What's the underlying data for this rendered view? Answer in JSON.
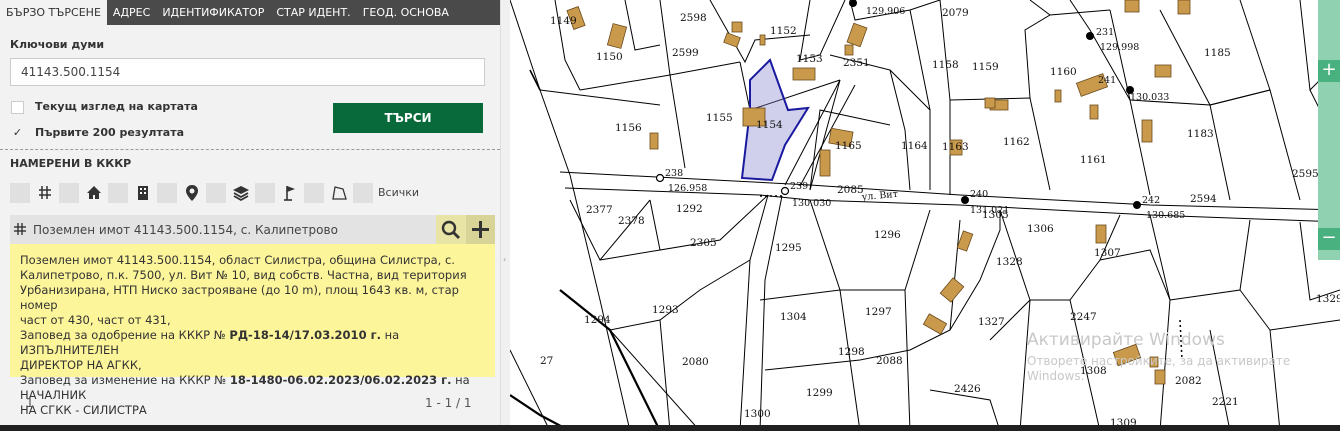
{
  "tabs": [
    "БЪРЗО ТЪРСЕНЕ",
    "АДРЕС",
    "ИДЕНТИФИКАТОР",
    "СТАР ИДЕНТ.",
    "ГЕОД. ОСНОВА"
  ],
  "keywords": {
    "label": "Ключови думи",
    "value": "41143.500.1154"
  },
  "checkboxes": [
    {
      "label": "Текущ изглед на картата",
      "checked": false
    },
    {
      "label": "Първите 200 резултата",
      "checked": true
    }
  ],
  "search_label": "ТЪРСИ",
  "found": {
    "title": "НАМЕРЕНИ В КККР",
    "all_label": "Всички"
  },
  "filter_icons": [
    "grid-icon",
    "home-icon",
    "building-icon",
    "pin-icon",
    "layers-icon",
    "flag-icon",
    "polygon-icon"
  ],
  "result": {
    "title": "Поземлен имот 41143.500.1154, с. Калипетрово",
    "lines": [
      "Поземлен имот 41143.500.1154, област Силистра, община Силистра, с.",
      "Калипетрово, п.к. 7500, ул. Вит № 10, вид собств. Частна, вид територия",
      "Урбанизирана, НТП Ниско застрояване (до 10 m), площ 1643 кв. м, стар номер",
      "част от 430, част от 431,"
    ],
    "order1_prefix": "Заповед за одобрение на КККР № ",
    "order1_bold": "РД-18-14/17.03.2010 г.",
    "order1_suffix": " на ИЗПЪЛНИТЕЛЕН",
    "order1_line2": "ДИРЕКТОР НА АГКК,",
    "order2_prefix": "Заповед за изменение на КККР № ",
    "order2_bold": "18-1480-06.02.2023/06.02.2023 г.",
    "order2_suffix": " на НАЧАЛНИК",
    "order2_line2": "НА СГКК - СИЛИСТРА"
  },
  "pagination": {
    "page": "1",
    "count": "1 - 1 / 1"
  },
  "map": {
    "parcels": [
      "1149",
      "2598",
      "1152",
      "2599",
      "1150",
      "1153",
      "2351",
      "1158",
      "1159",
      "1160",
      "1185",
      "1155",
      "1154",
      "1156",
      "1165",
      "1164",
      "1163",
      "1162",
      "1161",
      "1183",
      "2595",
      "2377",
      "2378",
      "1292",
      "2305",
      "2085",
      "1295",
      "1296",
      "1305",
      "1306",
      "2594",
      "1328",
      "1307",
      "1294",
      "1293",
      "1304",
      "1297",
      "1327",
      "2247",
      "27",
      "2080",
      "1298",
      "2088",
      "2426",
      "1308",
      "2082",
      "2221",
      "1299",
      "1300",
      "1309",
      "1329",
      "2079"
    ],
    "points": [
      {
        "id": "238",
        "elev": "126.958"
      },
      {
        "id": "239",
        "elev": "130.030"
      },
      {
        "id": "240",
        "elev": "131.021"
      },
      {
        "id": "242",
        "elev": "130.685"
      },
      {
        "id": "241",
        "elev": "130.033"
      },
      {
        "id": "231",
        "elev": "129.998"
      },
      {
        "id": "",
        "elev": "129.906"
      }
    ],
    "street": "ул. Вит",
    "highlight_color": "#1a1aa0"
  },
  "watermark": {
    "title": "Активирайте Windows",
    "text": "Отворете настройките, за да активирате Windows."
  }
}
